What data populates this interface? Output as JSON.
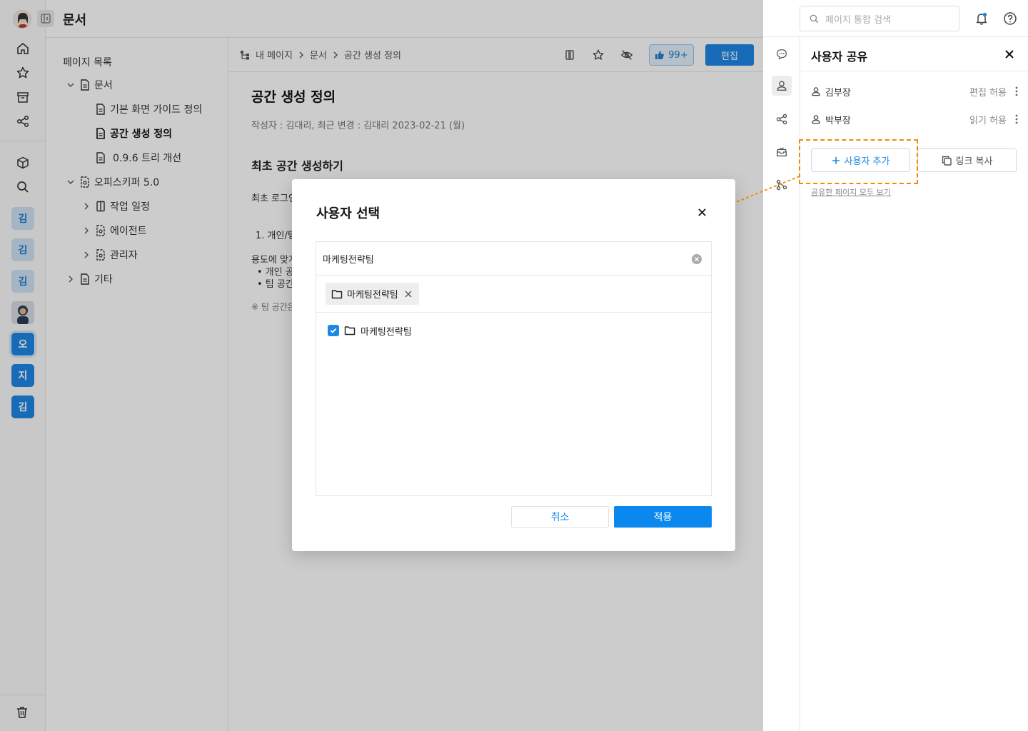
{
  "app": {
    "title": "문서"
  },
  "rail": {
    "chips": [
      "김",
      "김",
      "김",
      "오",
      "지",
      "김"
    ]
  },
  "tree": {
    "heading": "페이지 목록",
    "nodes": [
      {
        "label": "문서",
        "icon": "document-icon",
        "expanded": true
      },
      {
        "label": "기본 화면 가이드 정의",
        "icon": "document-icon"
      },
      {
        "label": "공간 생성 정의",
        "icon": "document-icon",
        "active": true
      },
      {
        "label": "0.9.6 트리 개선",
        "icon": "document-icon"
      },
      {
        "label": "오피스키퍼 5.0",
        "icon": "shared-document-icon",
        "expanded": true
      },
      {
        "label": "작업 일정",
        "icon": "board-icon"
      },
      {
        "label": "에이전트",
        "icon": "shared-document-icon"
      },
      {
        "label": "관리자",
        "icon": "shared-document-icon"
      },
      {
        "label": "기타",
        "icon": "document-icon"
      }
    ]
  },
  "breadcrumb": [
    "내 페이지",
    "문서",
    "공간 생성 정의"
  ],
  "toolbar": {
    "like_count": "99+",
    "edit_label": "편집"
  },
  "doc": {
    "title": "공간 생성 정의",
    "meta": "작성자 : 김대리,  최근 변경 : 김대리  2023-02-21 (월)",
    "section_title": "최초 공간 생성하기",
    "lines": [
      "최초 로그인",
      "1. 개인/팀",
      "용도에 맞게",
      "•  개인 공",
      "•  팀 공간",
      "※ 팀 공간은"
    ]
  },
  "right_panel": {
    "search_placeholder": "페이지 통합 검색",
    "title": "사용자 공유",
    "users": [
      {
        "name": "김부장",
        "permission": "편집 허용"
      },
      {
        "name": "박부장",
        "permission": "읽기 허용"
      }
    ],
    "add_user_label": "사용자 추가",
    "copy_link_label": "링크 복사",
    "view_all_label": "공유한 페이지 모두 보기",
    "highlight_color": "#f08c00"
  },
  "modal": {
    "title": "사용자 선택",
    "search_value": "마케팅전략팀",
    "selected_tag": "마케팅전략팀",
    "result_label": "마케팅전략팀",
    "result_checked": true,
    "cancel_label": "취소",
    "apply_label": "적용"
  },
  "colors": {
    "primary": "#1e88e5",
    "overlay": "rgba(0,0,0,0.2)"
  }
}
